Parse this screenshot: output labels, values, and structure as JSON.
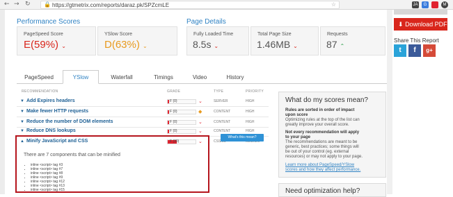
{
  "browser": {
    "back": "←",
    "forward": "→",
    "reload": "↻",
    "url": "https://gtmetrix.com/reports/daraz.pk/SPZcmLE",
    "lock": "🔒",
    "star": "☆",
    "ext1": "JA",
    "ext2": "G",
    "ext3": "M"
  },
  "sidebar": {
    "pdf_label": "Download PDF",
    "pdf_icon": "⬇",
    "share_title": "Share This Report",
    "twitter": "t",
    "facebook": "f",
    "google": "g+"
  },
  "performance": {
    "title": "Performance Scores",
    "pagespeed_label": "PageSpeed Score",
    "pagespeed_grade": "E",
    "pagespeed_pct": "(59%)",
    "yslow_label": "YSlow Score",
    "yslow_grade": "D",
    "yslow_pct": "(63%)"
  },
  "details": {
    "title": "Page Details",
    "load_label": "Fully Loaded Time",
    "load_value": "8.5s",
    "size_label": "Total Page Size",
    "size_value": "1.46MB",
    "req_label": "Requests",
    "req_value": "87"
  },
  "tabs": [
    "PageSpeed",
    "YSlow",
    "Waterfall",
    "Timings",
    "Video",
    "History"
  ],
  "table": {
    "col_rec": "RECOMMENDATION",
    "col_grade": "GRADE",
    "col_type": "TYPE",
    "col_priority": "PRIORITY",
    "rows": [
      {
        "name": "Add Expires headers",
        "grade": "F (0)",
        "type": "SERVER",
        "priority": "HIGH"
      },
      {
        "name": "Make fewer HTTP requests",
        "grade": "F (0)",
        "type": "CONTENT",
        "priority": "HIGH"
      },
      {
        "name": "Reduce the number of DOM elements",
        "grade": "F (0)",
        "type": "CONTENT",
        "priority": "HIGH"
      },
      {
        "name": "Reduce DNS lookups",
        "grade": "F (0)",
        "type": "CONTENT",
        "priority": "HIGH"
      },
      {
        "name": "Minify JavaScript and CSS",
        "grade": "F (30)",
        "type": "CSS/JS",
        "priority": "MEDIUM"
      }
    ]
  },
  "expanded": {
    "intro": "There are 7 components that can be minified",
    "button": "What's this mean?",
    "items": [
      "inline <script> tag #3",
      "inline <script> tag #7",
      "inline <script> tag #8",
      "inline <script> tag #9",
      "inline <script> tag #12",
      "inline <script> tag #13",
      "inline <script> tag #15"
    ]
  },
  "scores_panel": {
    "title": "What do my scores mean?",
    "bold1": "Rules are sorted in order of impact",
    "bold1b": "upon score",
    "text1": "Optimizing rules at the top of the list can",
    "text1b": "greatly improve your overall score.",
    "bold2": "Not every recommendation will apply",
    "bold2b": "to your page",
    "text2": "The recommendations are meant to be",
    "text2b": "generic, best practices; some things will",
    "text2c": "be out of your control (eg. external",
    "text2d": "resources) or may not apply to your page.",
    "link1": "Learn more about PageSpeed/YSlow",
    "link2": "scores and how they affect performance."
  },
  "opt_panel": {
    "title": "Need optimization help?"
  },
  "colors": {
    "accent": "#2f82c3",
    "grade_e": "#d9261c",
    "grade_d": "#e89a1e",
    "green": "#2a9d47"
  }
}
